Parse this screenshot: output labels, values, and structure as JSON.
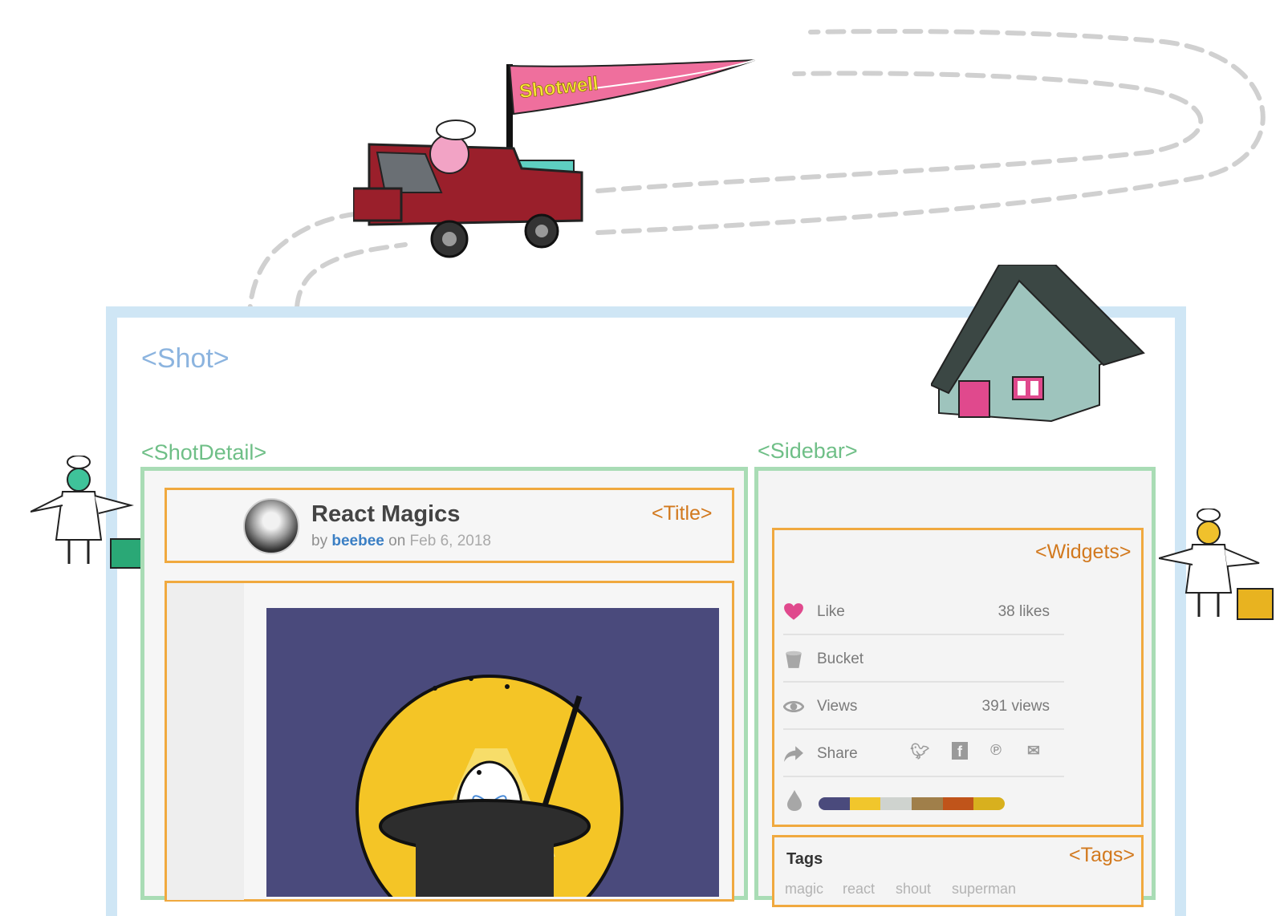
{
  "labels": {
    "shot": "<Shot>",
    "shot_detail": "<ShotDetail>",
    "sidebar": "<Sidebar>",
    "title": "<Title>",
    "widgets": "<Widgets>",
    "tags": "<Tags>"
  },
  "banner": {
    "text": "Shotwell"
  },
  "shot": {
    "title": "React Magics",
    "by": "by",
    "author": "beebee",
    "on": "on",
    "date": "Feb 6, 2018"
  },
  "widgets": {
    "like": {
      "label": "Like",
      "value": "38 likes",
      "icon": "heart-icon"
    },
    "bucket": {
      "label": "Bucket",
      "icon": "bucket-icon"
    },
    "views": {
      "label": "Views",
      "value": "391 views",
      "icon": "eye-icon"
    },
    "share": {
      "label": "Share",
      "icon": "share-icon",
      "networks": [
        "twitter-icon",
        "facebook-icon",
        "pinterest-icon",
        "mail-icon"
      ]
    },
    "palette": {
      "icon": "droplet-icon",
      "colors": [
        "#4a4a7c",
        "#f1c62c",
        "#cfd3cf",
        "#a07f4a",
        "#c0541a",
        "#d8b01e"
      ]
    }
  },
  "tags": {
    "title": "Tags",
    "items": [
      "magic",
      "react",
      "shout",
      "superman"
    ]
  },
  "colors": {
    "shot_frame": "#cfe6f5",
    "component_frame": "#a9dcb5",
    "subcomponent_frame": "#f0a93f"
  }
}
